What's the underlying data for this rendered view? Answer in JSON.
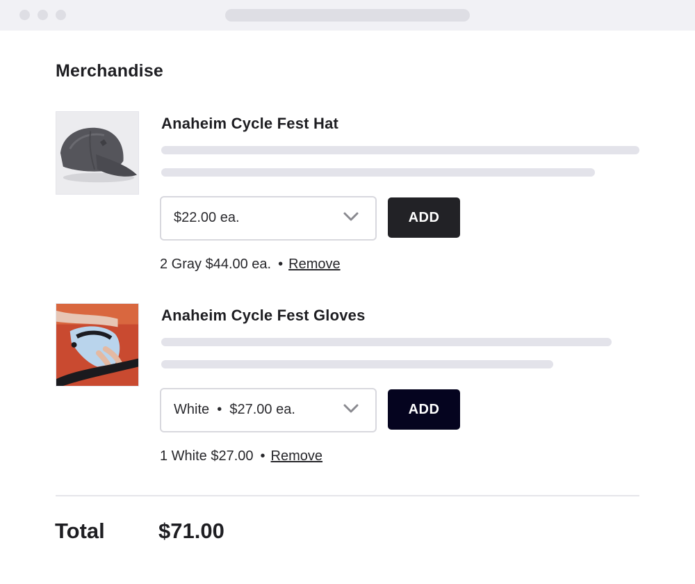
{
  "section": {
    "title": "Merchandise"
  },
  "items": [
    {
      "name": "Anaheim Cycle Fest Hat",
      "select_value": "$22.00 ea.",
      "add_label": "ADD",
      "selection_text": "2 Gray $44.00 ea.",
      "separator": "•",
      "remove_label": "Remove",
      "image": "gray-baseball-cap"
    },
    {
      "name": "Anaheim Cycle Fest Gloves",
      "select_value": "White  •  $27.00 ea.",
      "add_label": "ADD",
      "selection_text": "1 White $27.00",
      "separator": "•",
      "remove_label": "Remove",
      "image": "cycling-glove-on-handlebar"
    }
  ],
  "total": {
    "label": "Total",
    "value": "$71.00"
  },
  "colors": {
    "add_button_1": "#222226",
    "add_button_2": "#05041f",
    "skeleton": "#e3e3ea"
  }
}
